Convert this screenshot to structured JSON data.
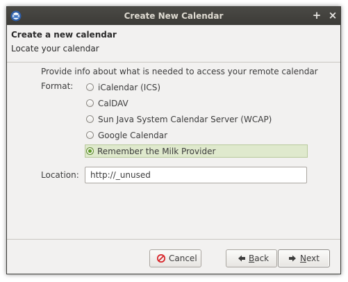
{
  "window": {
    "title": "Create New Calendar"
  },
  "header": {
    "title": "Create a new calendar",
    "subtitle": "Locate your calendar"
  },
  "intro": "Provide info about what is needed to access your remote calendar",
  "format": {
    "label": "Format:",
    "options": [
      {
        "label": "iCalendar (ICS)",
        "checked": false
      },
      {
        "label": "CalDAV",
        "checked": false
      },
      {
        "label": "Sun Java System Calendar Server (WCAP)",
        "checked": false
      },
      {
        "label": "Google Calendar",
        "checked": false
      },
      {
        "label": "Remember the Milk Provider",
        "checked": true
      }
    ]
  },
  "location": {
    "label": "Location:",
    "value": "http://_unused"
  },
  "buttons": {
    "cancel": {
      "label": "Cancel",
      "icon": "cancel-icon"
    },
    "back": {
      "label_mnemonic": "B",
      "label_rest": "ack",
      "icon": "arrow-left-icon"
    },
    "next": {
      "label_mnemonic": "N",
      "label_rest": "ext",
      "icon": "arrow-right-icon"
    }
  },
  "colors": {
    "selected_bg": "#dfe9cd",
    "radio_accent": "#5f9a2a",
    "cancel_red": "#d8262b"
  }
}
